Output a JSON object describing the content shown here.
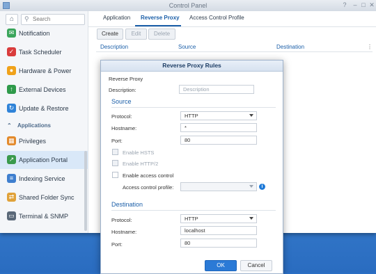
{
  "window": {
    "title": "Control Panel"
  },
  "sidebar": {
    "search_placeholder": "Search",
    "items": [
      {
        "label": "Notification",
        "color": "#3aa55b"
      },
      {
        "label": "Task Scheduler",
        "color": "#d93c3c"
      },
      {
        "label": "Hardware & Power",
        "color": "#f0a21a"
      },
      {
        "label": "External Devices",
        "color": "#2e9a4a"
      },
      {
        "label": "Update & Restore",
        "color": "#2f83d8"
      }
    ],
    "section_label": "Applications",
    "app_items": [
      {
        "label": "Privileges",
        "color": "#e38a2c"
      },
      {
        "label": "Application Portal",
        "color": "#3a9a4c"
      },
      {
        "label": "Indexing Service",
        "color": "#3f7fcf"
      },
      {
        "label": "Shared Folder Sync",
        "color": "#e0a23a"
      },
      {
        "label": "Terminal & SNMP",
        "color": "#5a6878"
      }
    ]
  },
  "tabs": [
    "Application",
    "Reverse Proxy",
    "Access Control Profile"
  ],
  "toolbar": {
    "create": "Create",
    "edit": "Edit",
    "delete": "Delete"
  },
  "table": {
    "headers": [
      "Description",
      "Source",
      "Destination"
    ]
  },
  "modal": {
    "title": "Reverse Proxy Rules",
    "subtitle": "Reverse Proxy",
    "description_label": "Description:",
    "description_placeholder": "Description",
    "source": {
      "heading": "Source",
      "protocol_label": "Protocol:",
      "protocol_value": "HTTP",
      "hostname_label": "Hostname:",
      "hostname_value": "*",
      "port_label": "Port:",
      "port_value": "80",
      "enable_hsts": "Enable HSTS",
      "enable_http2": "Enable HTTP/2",
      "enable_access_control": "Enable access control",
      "access_profile_label": "Access control profile:"
    },
    "destination": {
      "heading": "Destination",
      "protocol_label": "Protocol:",
      "protocol_value": "HTTP",
      "hostname_label": "Hostname:",
      "hostname_value": "localhost",
      "port_label": "Port:",
      "port_value": "80"
    },
    "ok": "OK",
    "cancel": "Cancel"
  }
}
